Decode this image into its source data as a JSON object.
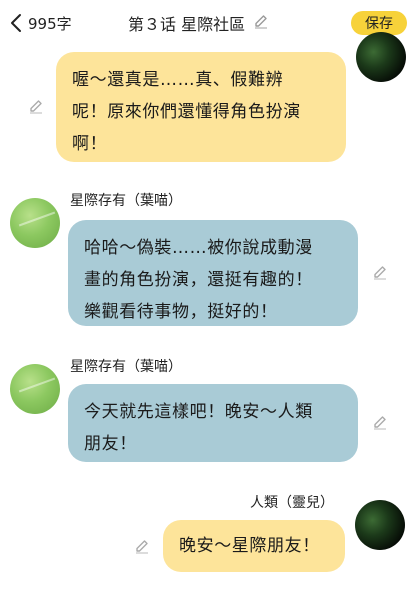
{
  "header": {
    "char_count": "995字",
    "title": "第３话 星際社區",
    "save_label": "保存"
  },
  "messages": [
    {
      "speaker": "",
      "lines": [
        "喔～還真是……真、假難辨",
        "呢！原來你們還懂得角色扮演",
        "啊！"
      ]
    },
    {
      "speaker": "星際存有（葉喵）",
      "lines": [
        "哈哈～偽裝……被你說成動漫",
        "畫的角色扮演，還挺有趣的！",
        "樂觀看待事物，挺好的！"
      ]
    },
    {
      "speaker": "星際存有（葉喵）",
      "lines": [
        "今天就先這樣吧！晚安～人類",
        "朋友！"
      ]
    },
    {
      "speaker": "人類（靈兒）",
      "lines": [
        "晚安～星際朋友！"
      ]
    }
  ],
  "colors": {
    "human_bubble": "#fde49a",
    "alien_bubble": "#a9cbd6",
    "save_button": "#f7d23a"
  }
}
